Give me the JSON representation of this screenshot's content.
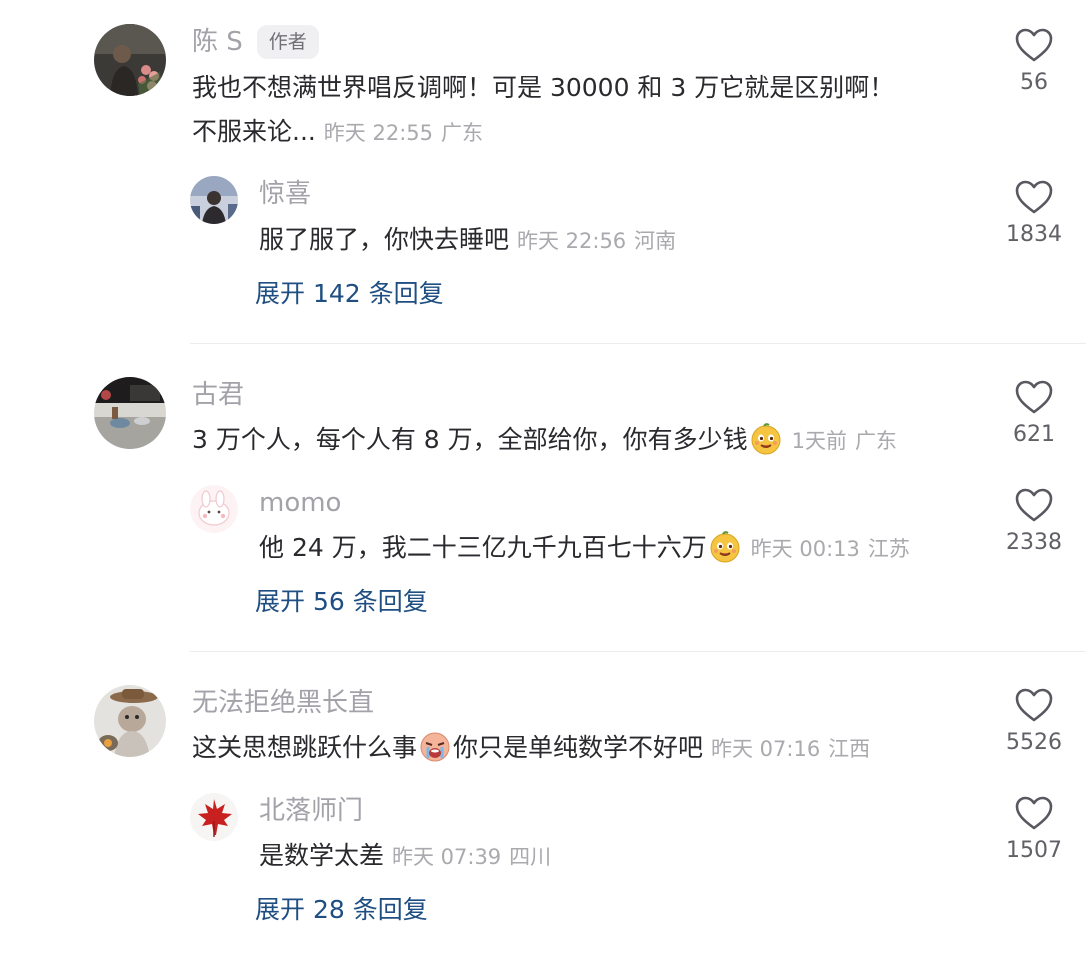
{
  "comments": [
    {
      "user": "陈 S",
      "badge": "作者",
      "avatar": "avatar-roses",
      "text_line1": "我也不想满世界唱反调啊！可是 30000 和 3 万它就是区别啊！",
      "text_line2": "不服来论...",
      "time": "昨天 22:55",
      "location": "广东",
      "likes": "56",
      "reply": {
        "user": "惊喜",
        "text": "服了服了，你快去睡吧",
        "time": "昨天 22:56",
        "location": "河南",
        "likes": "1834"
      },
      "expand": "展开 142 条回复"
    },
    {
      "user": "古君",
      "avatar": "avatar-desk",
      "text": "3 万个人，每个人有 8 万，全部给你，你有多少钱",
      "emoji": "smirk-face-emoji",
      "time": "1天前",
      "location": "广东",
      "likes": "621",
      "reply": {
        "user": "momo",
        "text": "他 24 万，我二十三亿九千九百七十六万",
        "emoji": "smirk-face-emoji",
        "time": "昨天 00:13",
        "location": "江苏",
        "likes": "2338"
      },
      "expand": "展开 56 条回复"
    },
    {
      "user": "无法拒绝黑长直",
      "avatar": "avatar-cat",
      "text_before": "这关思想跳跃什么事",
      "emoji": "crying-face-emoji",
      "text_after": "你只是单纯数学不好吧",
      "time": "昨天 07:16",
      "location": "江西",
      "likes": "5526",
      "reply": {
        "user": "北落师门",
        "text": "是数学太差",
        "time": "昨天 07:39",
        "location": "四川",
        "likes": "1507"
      },
      "expand": "展开 28 条回复"
    }
  ],
  "colors": {
    "name": "#a2a2a8",
    "text": "#2a2a2e",
    "meta": "#a9a9ae",
    "expand": "#1f4f82",
    "divider": "#ececee"
  }
}
